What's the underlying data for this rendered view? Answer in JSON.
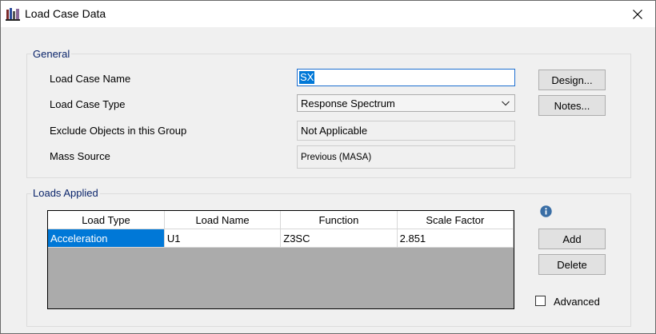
{
  "window": {
    "title": "Load Case Data"
  },
  "general": {
    "legend": "General",
    "load_case_name_label": "Load Case Name",
    "load_case_name_value": "SX",
    "load_case_type_label": "Load Case Type",
    "load_case_type_value": "Response Spectrum",
    "exclude_label": "Exclude Objects in this Group",
    "exclude_value": "Not Applicable",
    "mass_source_label": "Mass Source",
    "mass_source_value": "Previous  (MASA)",
    "design_button": "Design...",
    "notes_button": "Notes..."
  },
  "loads": {
    "legend": "Loads Applied",
    "columns": [
      "Load Type",
      "Load Name",
      "Function",
      "Scale Factor"
    ],
    "rows": [
      [
        "Acceleration",
        "U1",
        "Z3SC",
        "2.851"
      ]
    ],
    "add_button": "Add",
    "delete_button": "Delete",
    "advanced_label": "Advanced",
    "advanced_checked": false
  },
  "icons": {
    "app": "etabs-app-icon",
    "close": "close-icon",
    "dropdown": "chevron-down-icon",
    "info": "info-icon"
  },
  "colors": {
    "accent": "#0078d7",
    "legend_text": "#0a246a",
    "grid_empty": "#ababab"
  }
}
